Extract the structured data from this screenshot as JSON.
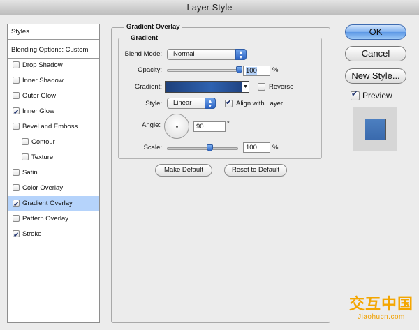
{
  "window": {
    "title": "Layer Style"
  },
  "styles_list": {
    "header": "Styles",
    "blending": "Blending Options: Custom",
    "items": [
      {
        "label": "Drop Shadow",
        "checked": false
      },
      {
        "label": "Inner Shadow",
        "checked": false
      },
      {
        "label": "Outer Glow",
        "checked": false
      },
      {
        "label": "Inner Glow",
        "checked": true
      },
      {
        "label": "Bevel and Emboss",
        "checked": false
      },
      {
        "label": "Contour",
        "checked": false
      },
      {
        "label": "Texture",
        "checked": false
      },
      {
        "label": "Satin",
        "checked": false
      },
      {
        "label": "Color Overlay",
        "checked": false
      },
      {
        "label": "Gradient Overlay",
        "checked": true
      },
      {
        "label": "Pattern Overlay",
        "checked": false
      },
      {
        "label": "Stroke",
        "checked": true
      }
    ]
  },
  "panel": {
    "title": "Gradient Overlay",
    "group_title": "Gradient",
    "blend_mode": {
      "label": "Blend Mode:",
      "value": "Normal"
    },
    "opacity": {
      "label": "Opacity:",
      "value": "100",
      "unit": "%",
      "slider_fraction": 1.0
    },
    "gradient": {
      "label": "Gradient:",
      "reverse_label": "Reverse",
      "reverse_checked": false
    },
    "style": {
      "label": "Style:",
      "value": "Linear",
      "align_label": "Align with Layer",
      "align_checked": true
    },
    "angle": {
      "label": "Angle:",
      "value": "90",
      "unit": "°"
    },
    "scale": {
      "label": "Scale:",
      "value": "100",
      "unit": "%",
      "slider_fraction": 0.5
    },
    "make_default": "Make Default",
    "reset_default": "Reset to Default"
  },
  "buttons": {
    "ok": "OK",
    "cancel": "Cancel",
    "new_style": "New Style...",
    "preview_label": "Preview",
    "preview_checked": true
  },
  "watermark": {
    "text": "交互中国",
    "url": "Jiaohucn.com"
  }
}
